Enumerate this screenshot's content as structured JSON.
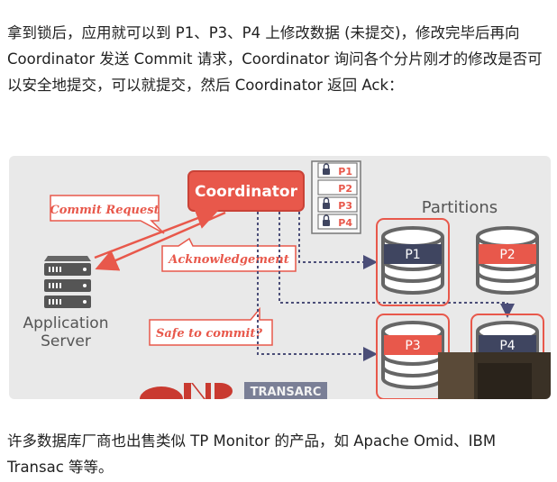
{
  "article": {
    "paragraph_1": "拿到锁后，应用就可以到 P1、P3、P4 上修改数据 (未提交)，修改完毕后再向 Coordinator 发送 Commit 请求，Coordinator 询问各个分片刚才的修改是否可以安全地提交，可以就提交，然后 Coordinator 返回 Ack：",
    "paragraph_2": "许多数据库厂商也出售类似 TP Monitor 的产品，如 Apache Omid、IBM Transac 等等。"
  },
  "diagram": {
    "coordinator": "Coordinator",
    "partitions_title": "Partitions",
    "lock_table": [
      "P1",
      "P2",
      "P3",
      "P4"
    ],
    "locked": [
      true,
      false,
      true,
      true
    ],
    "commit_request": "Commit Request",
    "acknowledgement": "Acknowledgement",
    "safe_to_commit": "Safe to commit?",
    "app_server_line1": "Application",
    "app_server_line2": "Server",
    "partitions": [
      "P1",
      "P2",
      "P3",
      "P4"
    ],
    "logo_text": "TRANSARC",
    "colors": {
      "accent_red": "#e8584b",
      "db_gray": "#666666",
      "p1_label_bg": "#3f4560",
      "dashed_blue": "#4b4e78"
    }
  }
}
